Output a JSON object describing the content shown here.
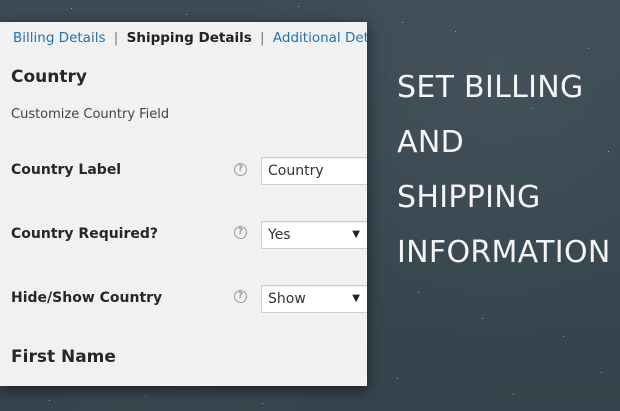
{
  "tabs": {
    "billing": "Billing Details",
    "shipping": "Shipping Details",
    "additional": "Additional Details",
    "separator": "|"
  },
  "section": {
    "country_title": "Country",
    "country_description": "Customize Country Field",
    "next_title": "First Name"
  },
  "fields": {
    "label": {
      "label": "Country Label",
      "value": "Country"
    },
    "required": {
      "label": "Country Required?",
      "value": "Yes"
    },
    "visibility": {
      "label": "Hide/Show Country",
      "value": "Show"
    }
  },
  "help_glyph": "?",
  "dropdown_glyph": "▼",
  "headline": {
    "line1": "SET BILLING",
    "line2": "AND",
    "line3": "SHIPPING",
    "line4": "INFORMATION"
  },
  "colors": {
    "background": "#3a4750",
    "panel": "#f1f1f1",
    "link": "#2271b1",
    "headline": "#f4f4f4"
  }
}
